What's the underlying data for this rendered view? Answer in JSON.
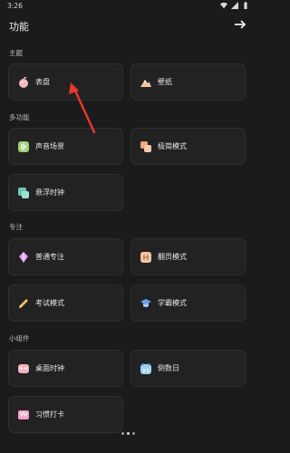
{
  "status_bar": {
    "time": "3:26"
  },
  "header": {
    "title": "功能"
  },
  "sections": {
    "theme": "主题",
    "multi": "多功能",
    "focus": "专注",
    "widget": "小组件"
  },
  "cards": {
    "dial": "表盘",
    "wallpaper": "壁纸",
    "sound_scene": "声音场景",
    "minimal_mode": "极简模式",
    "floating_clock": "悬浮时钟",
    "normal_focus": "普通专注",
    "flip_mode": "翻页模式",
    "exam_mode": "考试模式",
    "scholar_mode": "学霸模式",
    "desktop_clock": "桌面时钟",
    "countdown_day": "倒数日",
    "habit_checkin": "习惯打卡"
  },
  "colors": {
    "background": "#1b1b1b",
    "card": "#222222",
    "arrow": "#e8362b"
  },
  "icons": {
    "dial": "peach-icon",
    "wallpaper": "mountain-icon",
    "sound_scene": "sound-icon",
    "minimal_mode": "minimal-icon",
    "floating_clock": "float-icon",
    "normal_focus": "gem-icon",
    "flip_mode": "flip-icon",
    "exam_mode": "pencil-icon",
    "scholar_mode": "graduation-cap-icon",
    "desktop_clock": "clock-icon",
    "countdown_day": "calendar-icon",
    "habit_checkin": "checkin-icon"
  },
  "pager": {
    "pages": 3,
    "active": 2
  }
}
